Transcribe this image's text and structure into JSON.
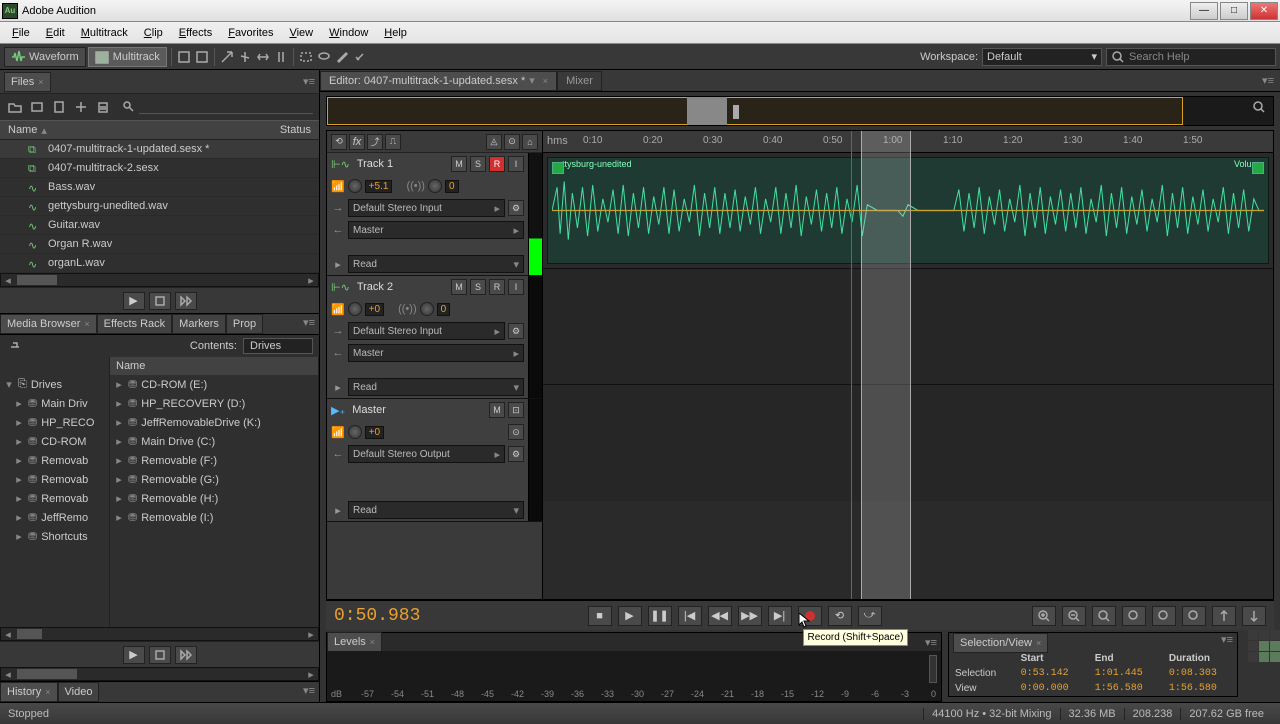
{
  "app": {
    "title": "Adobe Audition",
    "icon_text": "Au"
  },
  "window_buttons": {
    "min": "—",
    "max": "□",
    "close": "✕"
  },
  "menu": [
    "File",
    "Edit",
    "Multitrack",
    "Clip",
    "Effects",
    "Favorites",
    "View",
    "Window",
    "Help"
  ],
  "toolbar": {
    "waveform": "Waveform",
    "multitrack": "Multitrack",
    "workspace_label": "Workspace:",
    "workspace_value": "Default",
    "search_placeholder": "Search Help"
  },
  "files_panel": {
    "tab": "Files",
    "columns": {
      "name": "Name",
      "status": "Status"
    },
    "items": [
      {
        "name": "0407-multitrack-1-updated.sesx *",
        "type": "sesx"
      },
      {
        "name": "0407-multitrack-2.sesx",
        "type": "sesx"
      },
      {
        "name": "Bass.wav",
        "type": "wav"
      },
      {
        "name": "gettysburg-unedited.wav",
        "type": "wav"
      },
      {
        "name": "Guitar.wav",
        "type": "wav"
      },
      {
        "name": "Organ R.wav",
        "type": "wav"
      },
      {
        "name": "organL.wav",
        "type": "wav"
      }
    ]
  },
  "browser": {
    "tabs": [
      "Media Browser",
      "Effects Rack",
      "Markers",
      "Prop"
    ],
    "contents_label": "Contents:",
    "contents_value": "Drives",
    "pane1": {
      "header": "Drives",
      "items": [
        "Main Driv",
        "HP_RECO",
        "CD-ROM",
        "Removab",
        "Removab",
        "Removab",
        "JeffRemo",
        "Shortcuts"
      ]
    },
    "pane2": {
      "header": "Name",
      "items": [
        "CD-ROM (E:)",
        "HP_RECOVERY (D:)",
        "JeffRemovableDrive (K:)",
        "Main Drive (C:)",
        "Removable (F:)",
        "Removable (G:)",
        "Removable (H:)",
        "Removable (I:)"
      ]
    }
  },
  "history": {
    "tabs": [
      "History",
      "Video"
    ]
  },
  "editor": {
    "tab_label": "Editor: 0407-multitrack-1-updated.sesx *",
    "mixer": "Mixer",
    "ruler_unit": "hms",
    "ruler_ticks": [
      "0:10",
      "0:20",
      "0:30",
      "0:40",
      "0:50",
      "1:00",
      "1:10",
      "1:20",
      "1:30",
      "1:40",
      "1:50"
    ],
    "timecode": "0:50.983",
    "clip_label": "gettysburg-unedited",
    "clip_volume": "Volume"
  },
  "tracks": [
    {
      "name": "Track 1",
      "gain": "+5.1",
      "pan": "0",
      "input": "Default Stereo Input",
      "output": "Master",
      "auto": "Read",
      "armed": true
    },
    {
      "name": "Track 2",
      "gain": "+0",
      "pan": "0",
      "input": "Default Stereo Input",
      "output": "Master",
      "auto": "Read",
      "armed": false
    },
    {
      "name": "Master",
      "gain": "+0",
      "pan": "",
      "input": "",
      "output": "Default Stereo Output",
      "auto": "Read",
      "armed": false,
      "master": true
    }
  ],
  "track_buttons": {
    "m": "M",
    "s": "S",
    "r": "R",
    "i": "I"
  },
  "tooltip": "Record (Shift+Space)",
  "levels": {
    "tab": "Levels",
    "scale": [
      "dB",
      "-57",
      "-54",
      "-51",
      "-48",
      "-45",
      "-42",
      "-39",
      "-36",
      "-33",
      "-30",
      "-27",
      "-24",
      "-21",
      "-18",
      "-15",
      "-12",
      "-9",
      "-6",
      "-3",
      "0"
    ]
  },
  "selection_view": {
    "tab": "Selection/View",
    "cols": [
      "",
      "Start",
      "End",
      "Duration"
    ],
    "rows": [
      {
        "label": "Selection",
        "start": "0:53.142",
        "end": "1:01.445",
        "dur": "0:08.303"
      },
      {
        "label": "View",
        "start": "0:00.000",
        "end": "1:56.580",
        "dur": "1:56.580"
      }
    ]
  },
  "status": {
    "state": "Stopped",
    "sr": "44100 Hz",
    "bits": "32-bit Mixing",
    "mem": "32.36 MB",
    "dur": "208.238",
    "disk": "207.62 GB free"
  }
}
